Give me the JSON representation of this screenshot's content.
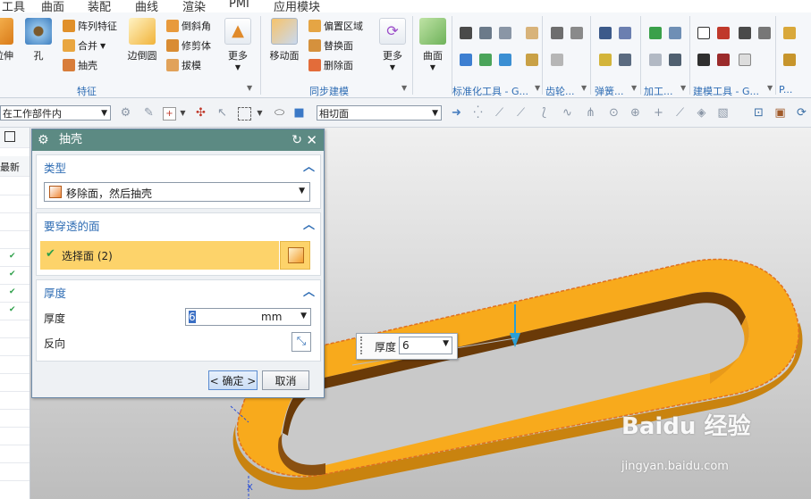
{
  "menubar": [
    "工具",
    "曲面",
    "装配",
    "曲线",
    "渲染",
    "PMI",
    "应用模块"
  ],
  "ribbon": {
    "feature_group": {
      "label": "特征",
      "extrude": "拉伸",
      "hole": "孔",
      "pattern_feature": "阵列特征",
      "combine": "合并",
      "shell": "抽壳",
      "edge_blend": "边倒圆",
      "chamfer": "倒斜角",
      "trim_body": "修剪体",
      "draft": "拔模",
      "more": "更多"
    },
    "sync_group": {
      "label": "同步建模",
      "move_face": "移动面",
      "offset_region": "偏置区域",
      "replace_face": "替换面",
      "delete_face": "删除面",
      "more": "更多"
    },
    "surface": "曲面",
    "std_tools_label": "标准化工具 - G...",
    "gear_label": "齿轮...",
    "spring_label": "弹簧...",
    "machining_label": "加工...",
    "modeling_tools_label": "建模工具 - G...",
    "p_label": "P..."
  },
  "toolbar2": {
    "scope_value": "在工作部件内",
    "snap_value": "相切面"
  },
  "leftnav": {
    "header": "最新"
  },
  "dialog": {
    "title": "抽壳",
    "type_section": "类型",
    "type_value": "移除面，然后抽壳",
    "pierce_section": "要穿透的面",
    "select_face": "选择面 (2)",
    "thickness_section": "厚度",
    "thickness_label": "厚度",
    "thickness_value": "6",
    "thickness_unit": "mm",
    "reverse_label": "反向",
    "ok": "< 确定 >",
    "cancel": "取消"
  },
  "float": {
    "label": "厚度",
    "value": "6"
  },
  "axis_label": "X",
  "watermark": {
    "brand": "Baidu 经验",
    "url": "jingyan.baidu.com"
  },
  "colors": {
    "part": "#f8aa1c",
    "part_inner": "#6a3a08",
    "dialog_title": "#5c8a83",
    "accent": "#2f6db4",
    "selected": "#fdd36a"
  }
}
